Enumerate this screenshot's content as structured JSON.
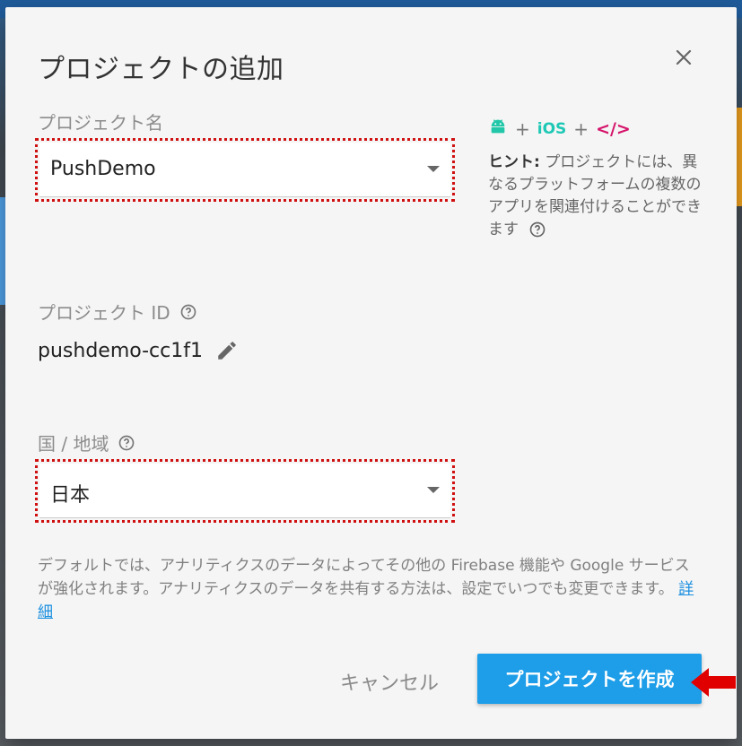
{
  "dialog": {
    "title": "プロジェクトの追加",
    "close_icon": "close-icon"
  },
  "project_name": {
    "label": "プロジェクト名",
    "value": "PushDemo"
  },
  "hint": {
    "platforms": [
      "android-icon",
      "iOS",
      "web-code-icon"
    ],
    "ios_text": "iOS",
    "web_text": "</>",
    "plus": "+",
    "title": "ヒント:",
    "body": " プロジェクトには、異なるプラットフォームの複数のアプリを関連付けることができます"
  },
  "project_id": {
    "label": "プロジェクト ID",
    "value": "pushdemo-cc1f1"
  },
  "region": {
    "label": "国 / 地域",
    "value": "日本"
  },
  "footnote": {
    "text": "デフォルトでは、アナリティクスのデータによってその他の Firebase 機能や Google サービスが強化されます。アナリティクスのデータを共有する方法は、設定でいつでも変更できます。",
    "link": "詳細"
  },
  "actions": {
    "cancel": "キャンセル",
    "create": "プロジェクトを作成"
  },
  "colors": {
    "primary": "#1e9ee8",
    "highlight": "#d01010",
    "android": "#21c7a8",
    "ios": "#1ec8b5",
    "web": "#d5146b"
  }
}
